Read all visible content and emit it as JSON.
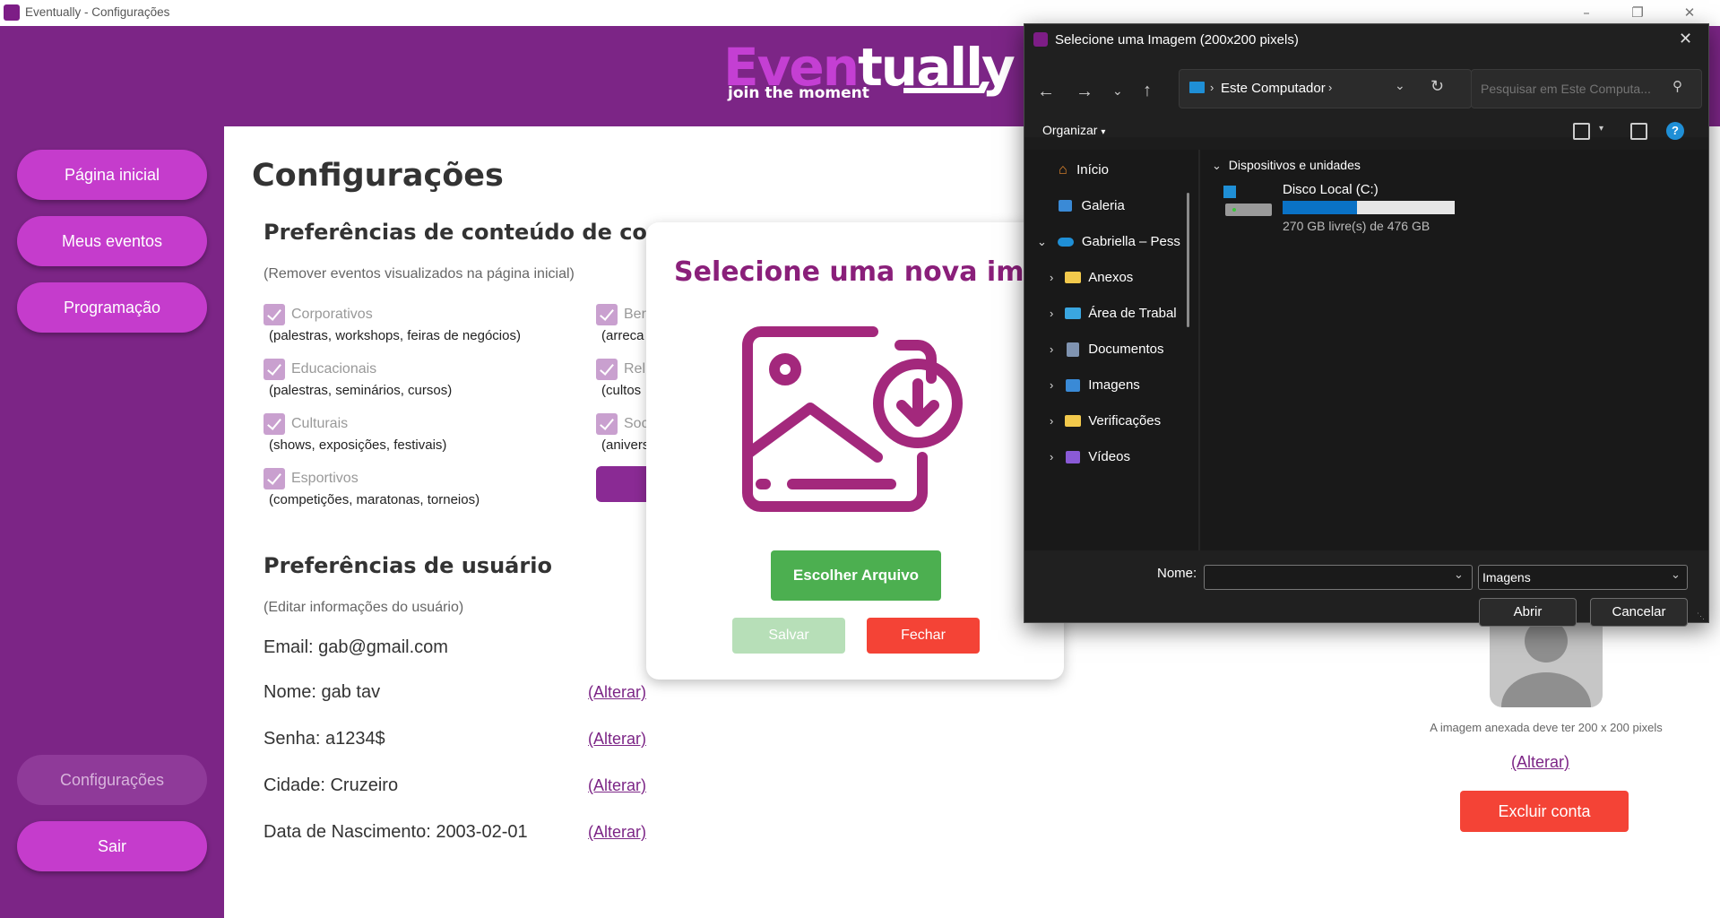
{
  "window": {
    "title": "Eventually - Configurações"
  },
  "header": {
    "logo_part1": "Even",
    "logo_part2": "tually",
    "logo_tagline": "join the moment"
  },
  "sidebar": {
    "items": [
      {
        "label": "Página inicial"
      },
      {
        "label": "Meus eventos"
      },
      {
        "label": "Programação"
      },
      {
        "label": "Configurações"
      },
      {
        "label": "Sair"
      }
    ]
  },
  "main": {
    "title": "Configurações",
    "content_prefs": {
      "title": "Preferências de conteúdo de com",
      "hint": "(Remover eventos visualizados na página inicial)",
      "left_items": [
        {
          "label": "Corporativos",
          "desc": "(palestras, workshops, feiras de negócios)"
        },
        {
          "label": "Educacionais",
          "desc": "(palestras, seminários, cursos)"
        },
        {
          "label": "Culturais",
          "desc": "(shows, exposições, festivais)"
        },
        {
          "label": "Esportivos",
          "desc": "(competições, maratonas, torneios)"
        }
      ],
      "right_items": [
        {
          "label": "Ber",
          "desc": "(arreca"
        },
        {
          "label": "Rel",
          "desc": "(cultos"
        },
        {
          "label": "Soc",
          "desc": "(anivers"
        }
      ]
    },
    "user_prefs": {
      "title": "Preferências de usuário",
      "hint": "(Editar informações do usuário)",
      "email": "Email:  gab@gmail.com",
      "nome": "Nome:  gab tav",
      "senha": "Senha:  a1234$",
      "cidade": "Cidade:  Cruzeiro",
      "nascimento": "Data de Nascimento:  2003-02-01",
      "alterar": "(Alterar)"
    }
  },
  "profile": {
    "image_note": "A imagem anexada deve ter 200 x 200 pixels",
    "alterar": "(Alterar)",
    "delete_button": "Excluir conta"
  },
  "modal": {
    "title": "Selecione uma nova imagem",
    "choose_button": "Escolher Arquivo",
    "save_button": "Salvar",
    "close_button": "Fechar"
  },
  "file_dialog": {
    "title": "Selecione uma Imagem (200x200 pixels)",
    "address": "Este Computador",
    "search_placeholder": "Pesquisar em Este Computa...",
    "organize": "Organizar",
    "nav": [
      {
        "label": "Início",
        "icon": "home-icon"
      },
      {
        "label": "Galeria",
        "icon": "gallery-icon"
      },
      {
        "label": "Gabriella – Pess",
        "icon": "onedrive-icon"
      },
      {
        "label": "Anexos",
        "icon": "folder-icon"
      },
      {
        "label": "Área de Trabal",
        "icon": "desktop-icon"
      },
      {
        "label": "Documentos",
        "icon": "documents-icon"
      },
      {
        "label": "Imagens",
        "icon": "pictures-icon"
      },
      {
        "label": "Verificações",
        "icon": "folder-icon"
      },
      {
        "label": "Vídeos",
        "icon": "videos-icon"
      }
    ],
    "group_header": "Dispositivos e unidades",
    "drive": {
      "name": "Disco Local (C:)",
      "space": "270 GB livre(s) de 476 GB",
      "used_fraction": 0.43
    },
    "name_label": "Nome:",
    "name_value": "",
    "filter": "Imagens",
    "open_button": "Abrir",
    "cancel_button": "Cancelar"
  },
  "colors": {
    "brand_purple": "#7c2586",
    "button_pink": "#c53ccc",
    "danger": "#f44336",
    "success": "#4caf50"
  }
}
